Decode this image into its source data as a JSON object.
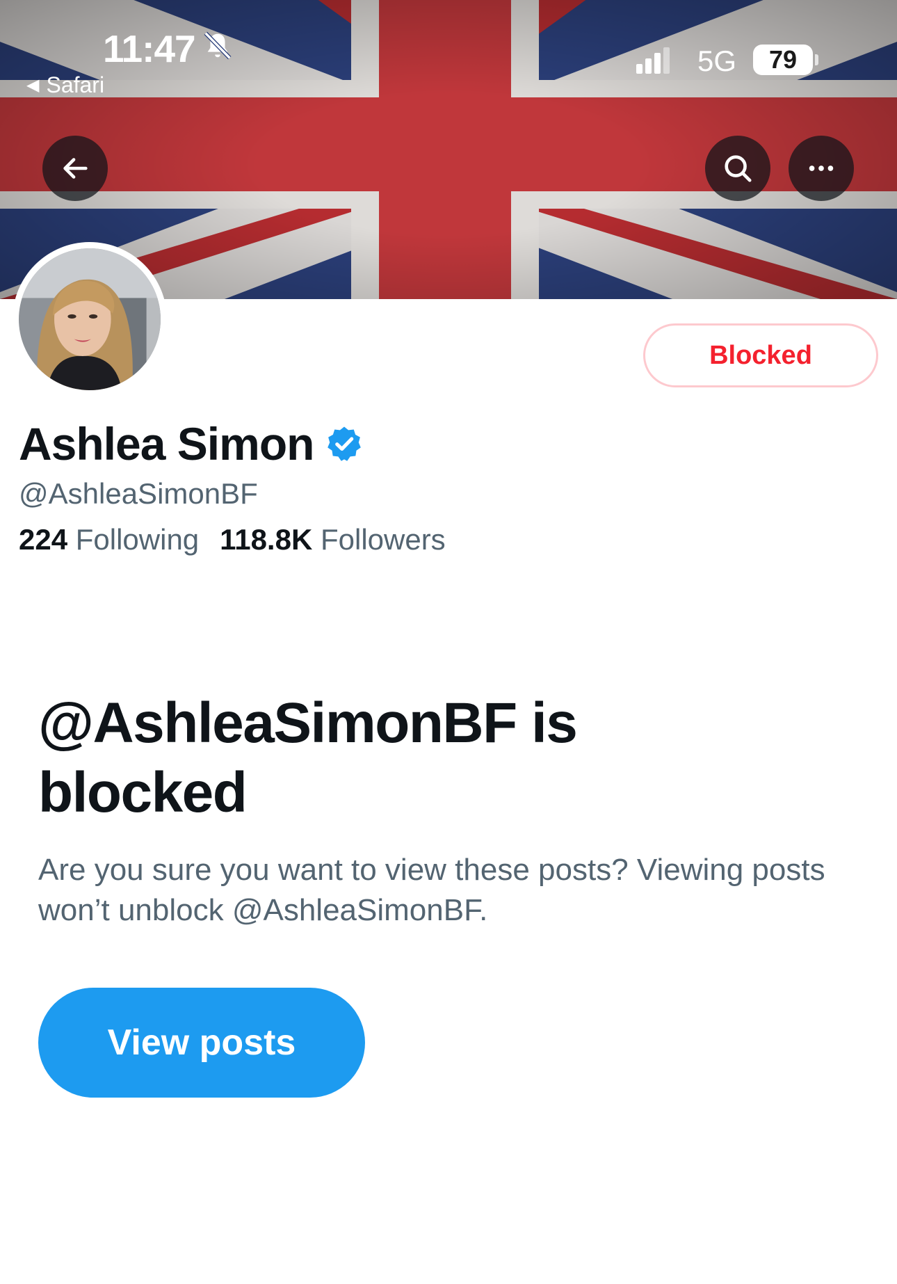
{
  "status_bar": {
    "time": "11:47",
    "back_app": "Safari",
    "network": "5G",
    "battery": "79"
  },
  "banner": {
    "description_icon": "union-jack-flag",
    "back_icon": "arrow-left-icon",
    "search_icon": "search-icon",
    "more_icon": "more-icon"
  },
  "profile": {
    "display_name": "Ashlea Simon",
    "handle": "@AshleaSimonBF",
    "following_count": "224",
    "following_label": "Following",
    "followers_count": "118.8K",
    "followers_label": "Followers",
    "blocked_button": "Blocked"
  },
  "blocked_notice": {
    "title": "@AshleaSimonBF is blocked",
    "description": "Are you sure you want to view these posts? Viewing posts won’t unblock @AshleaSimonBF.",
    "view_button": "View posts"
  },
  "colors": {
    "accent": "#1d9bf0",
    "blocked_red": "#f4212e",
    "secondary_text": "#536471"
  }
}
